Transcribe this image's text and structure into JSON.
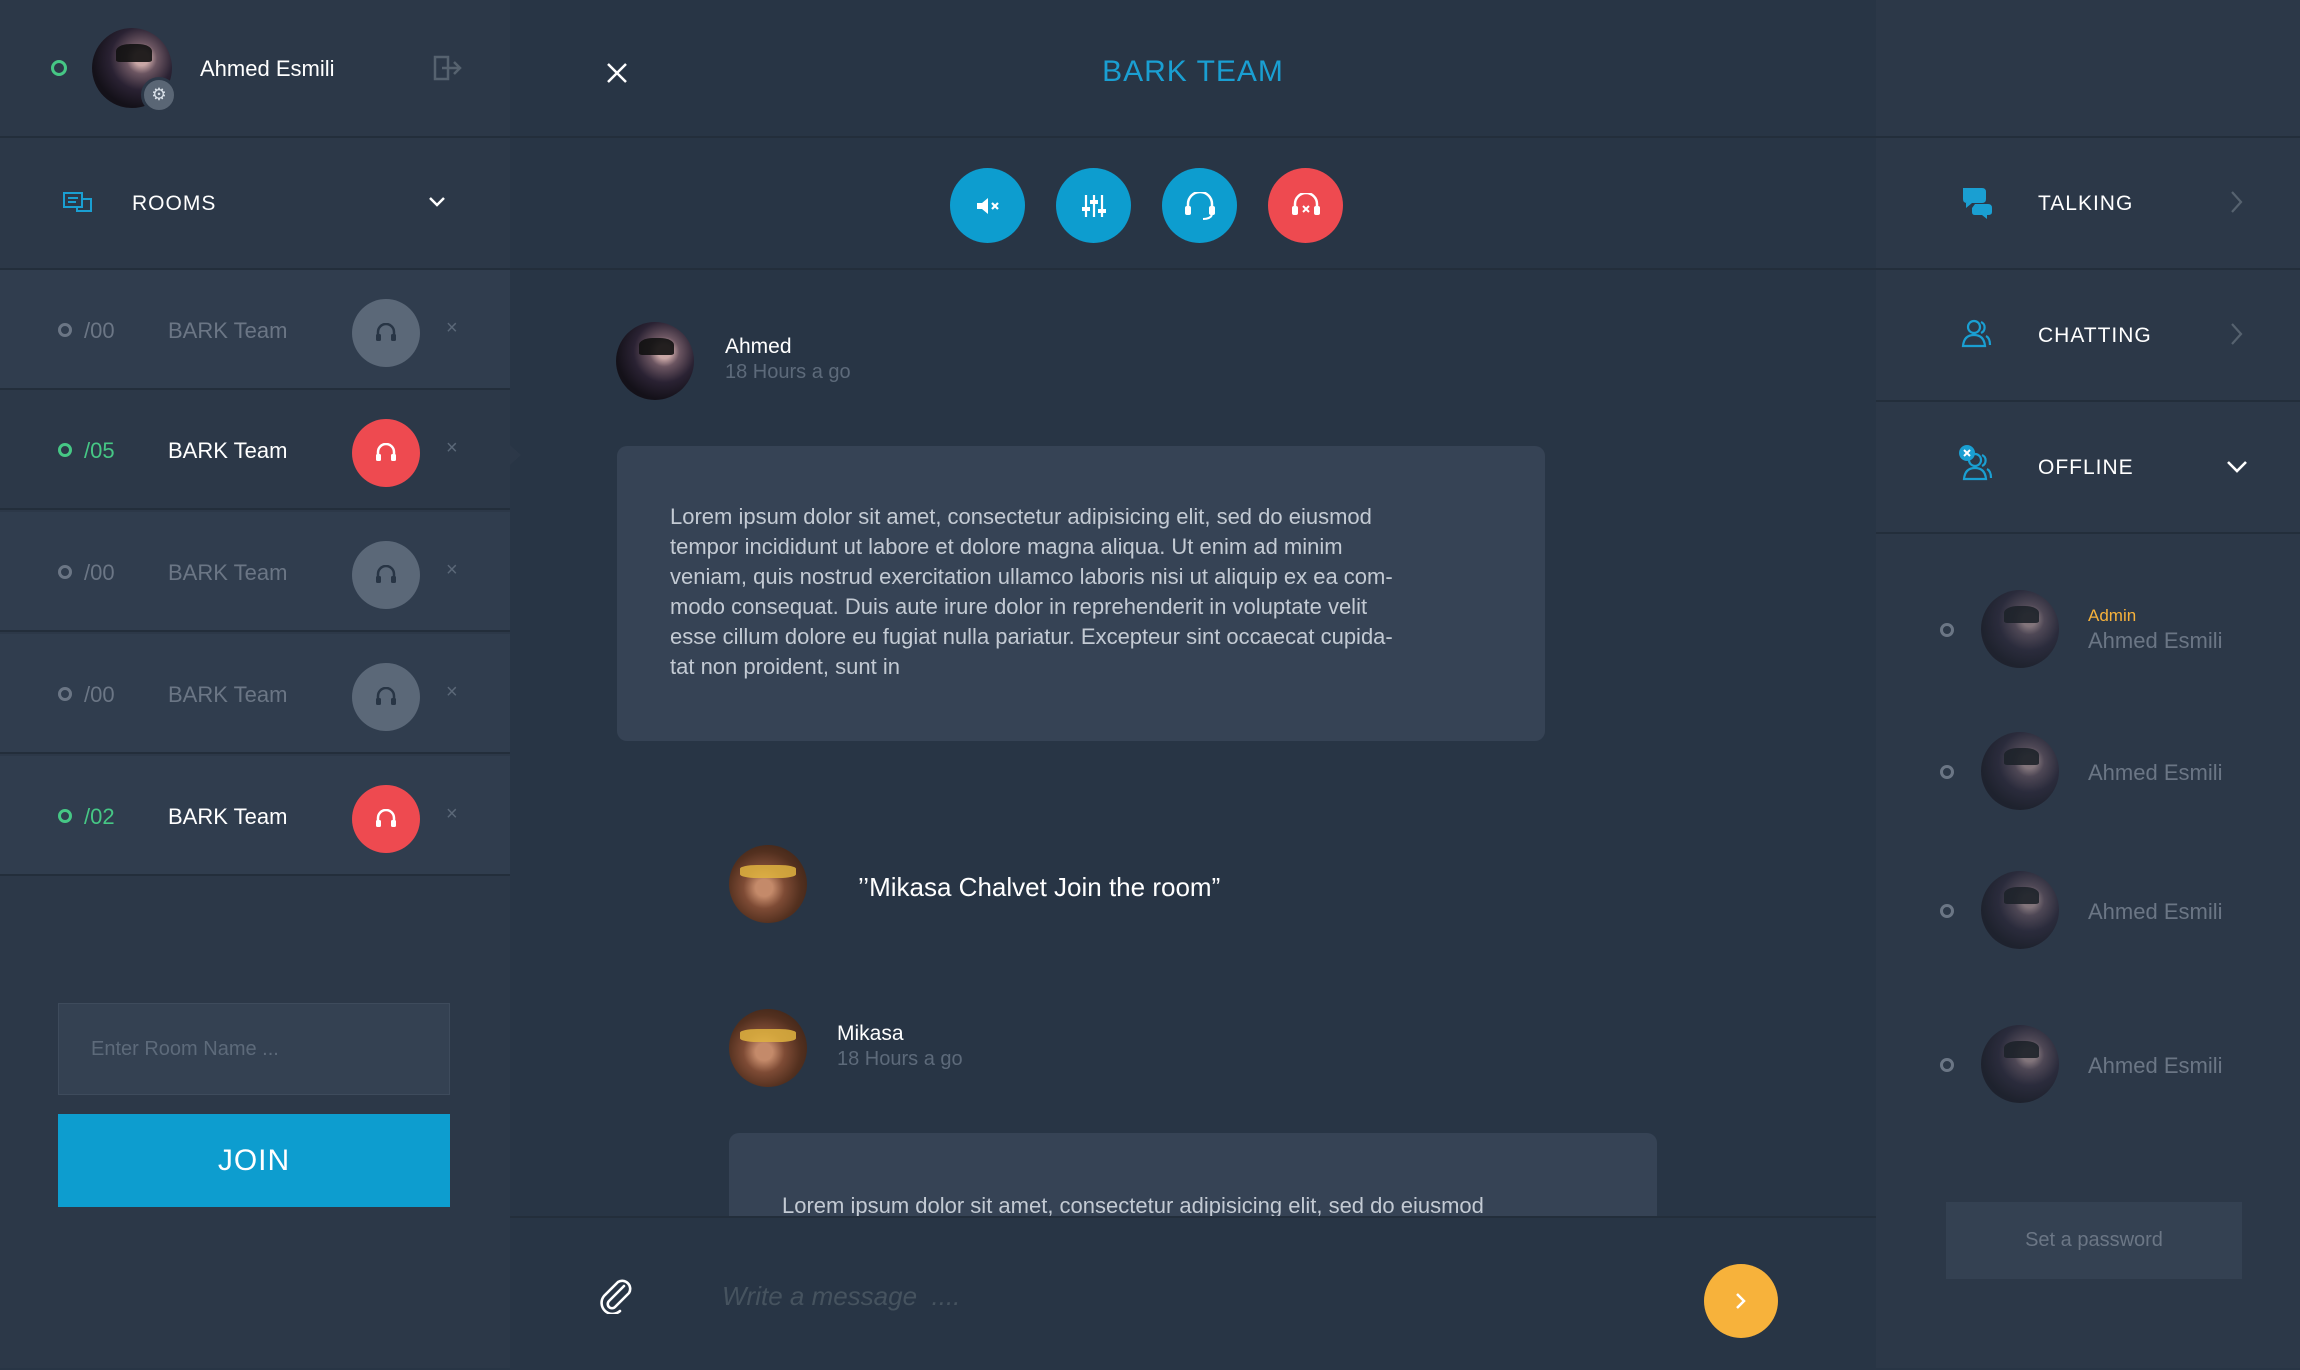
{
  "user": {
    "name": "Ahmed Esmili",
    "status": "online"
  },
  "rooms_section": {
    "title": "ROOMS"
  },
  "rooms": [
    {
      "number": "/00",
      "name": "BARK Team",
      "active": false
    },
    {
      "number": "/05",
      "name": "BARK Team",
      "active": true
    },
    {
      "number": "/00",
      "name": "BARK Team",
      "active": false
    },
    {
      "number": "/00",
      "name": "BARK Team",
      "active": false
    },
    {
      "number": "/02",
      "name": "BARK Team",
      "active": true
    }
  ],
  "join_form": {
    "placeholder": "Enter Room Name ...",
    "button": "JOIN"
  },
  "chat": {
    "title": "BARK TEAM",
    "controls": [
      "mute-icon",
      "equalizer-icon",
      "headset-icon",
      "headset-off-icon"
    ],
    "messages": [
      {
        "author": "Ahmed",
        "time": "18 Hours a go",
        "text": [
          "Lorem ipsum dolor sit amet, consectetur adipisicing elit, sed do eiusmod",
          "tempor incididunt ut labore et dolore magna aliqua. Ut enim ad minim",
          "veniam, quis nostrud exercitation ullamco laboris nisi ut aliquip ex ea com-",
          "modo consequat. Duis aute irure dolor in reprehenderit in voluptate velit",
          "esse cillum dolore eu fugiat nulla pariatur. Excepteur sint occaecat cupida-",
          "tat non proident, sunt in"
        ]
      },
      {
        "author": "Mikasa",
        "time": "18 Hours a go",
        "text": [
          "Lorem ipsum dolor sit amet, consectetur adipisicing elit, sed do eiusmod"
        ]
      }
    ],
    "join_notice": "’’Mikasa Chalvet Join the room”",
    "composer_placeholder": "Write a message  ...."
  },
  "right": {
    "sections": [
      {
        "label": "TALKING",
        "expanded": false
      },
      {
        "label": "CHATTING",
        "expanded": false
      },
      {
        "label": "OFFLINE",
        "expanded": true
      }
    ],
    "users": [
      {
        "role": "Admin",
        "name": "Ahmed Esmili"
      },
      {
        "role": "",
        "name": "Ahmed Esmili"
      },
      {
        "role": "",
        "name": "Ahmed Esmili"
      },
      {
        "role": "",
        "name": "Ahmed Esmili"
      }
    ],
    "set_password": "Set a password"
  },
  "colors": {
    "accent": "#0d9dcf",
    "danger": "#ee4a50",
    "online": "#46c785",
    "send": "#f7b23b",
    "admin": "#f7b23b"
  }
}
